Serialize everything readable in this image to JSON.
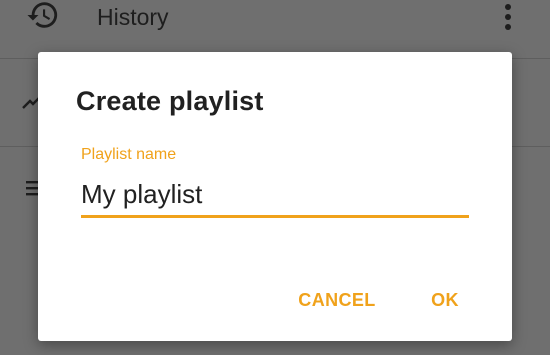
{
  "background": {
    "history_label": "History",
    "icons": [
      "history-icon",
      "more-vert-icon",
      "trending-icon",
      "list-icon"
    ]
  },
  "dialog": {
    "title": "Create playlist",
    "field_label": "Playlist name",
    "field_value": "My playlist",
    "cancel_label": "CANCEL",
    "ok_label": "OK"
  },
  "colors": {
    "accent": "#f0a21b",
    "scrim": "#6f6f6f",
    "dialog_bg": "#ffffff",
    "text": "#212121"
  }
}
